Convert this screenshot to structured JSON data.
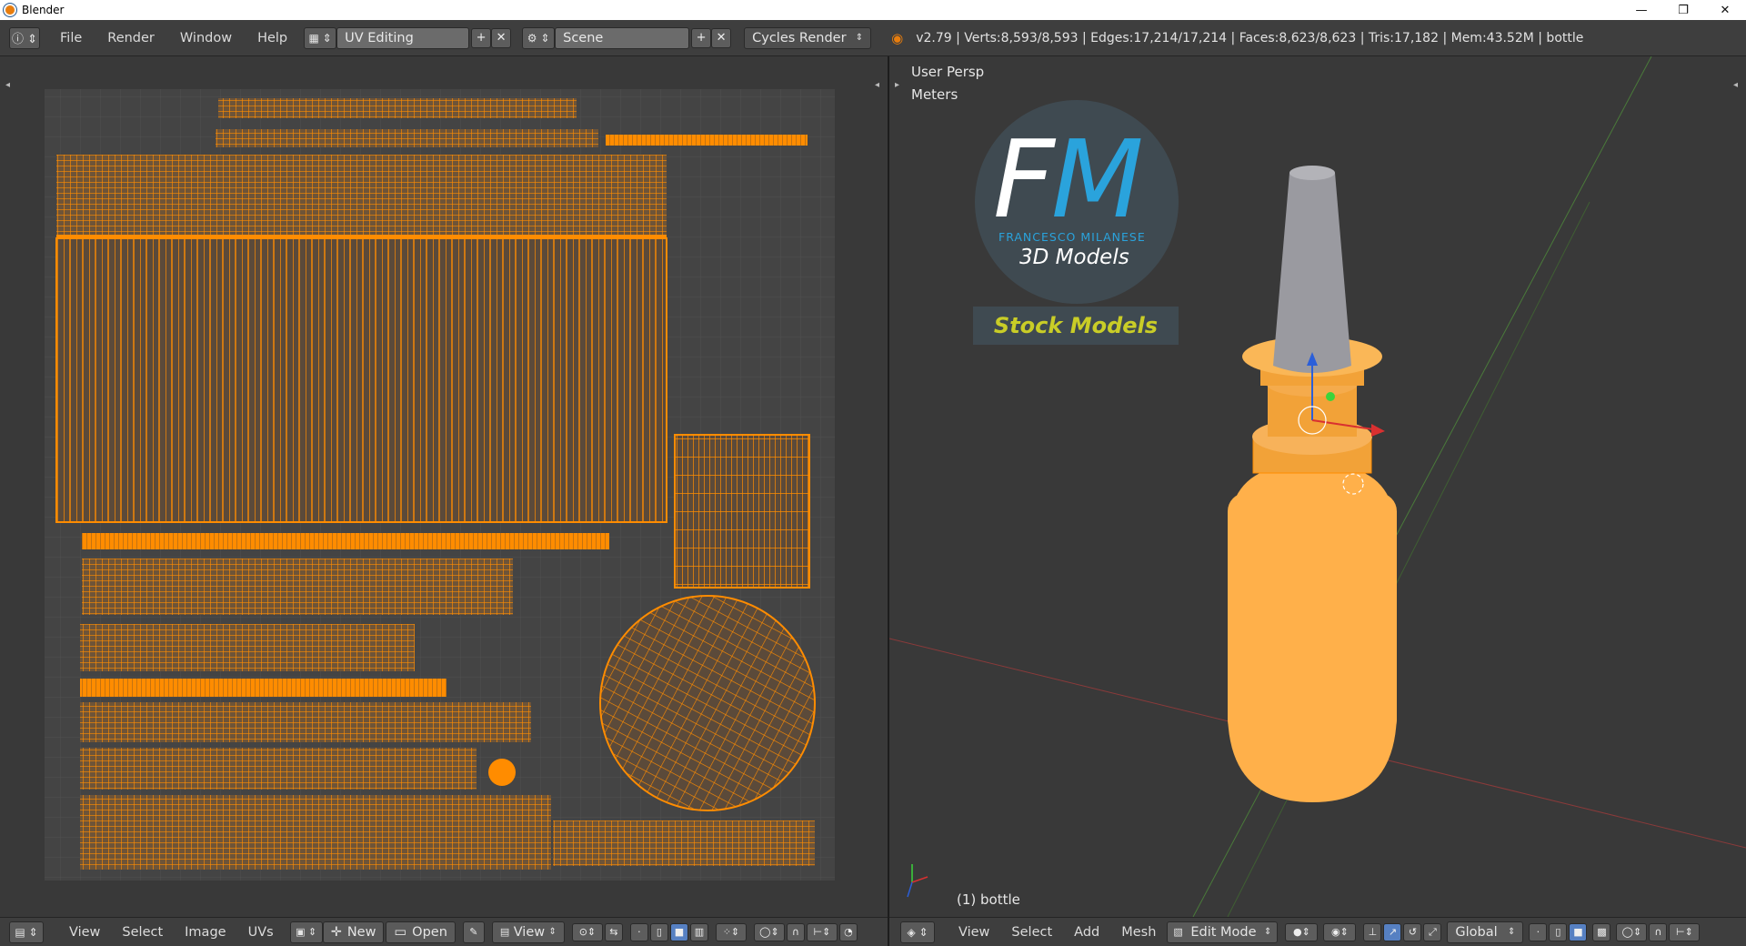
{
  "window": {
    "title": "Blender",
    "minimize": "—",
    "maximize": "❐",
    "close": "✕"
  },
  "topbar": {
    "menus": [
      "File",
      "Render",
      "Window",
      "Help"
    ],
    "layout": "UV Editing",
    "scene": "Scene",
    "engine": "Cycles Render",
    "stats": "v2.79 | Verts:8,593/8,593 | Edges:17,214/17,214 | Faces:8,623/8,623 | Tris:17,182 | Mem:43.52M | bottle"
  },
  "uv_editor": {
    "menus": [
      "View",
      "Select",
      "Image",
      "UVs"
    ],
    "new_label": "New",
    "open_label": "Open",
    "view_label": "View",
    "colors": {
      "bg": "#393939",
      "grid": "#4a4a4a",
      "uv": "#ff8c00"
    }
  },
  "viewport": {
    "view_name": "User Persp",
    "units": "Meters",
    "object_label": "(1) bottle",
    "menus": [
      "View",
      "Select",
      "Add",
      "Mesh"
    ],
    "mode": "Edit Mode",
    "orientation": "Global",
    "logo": {
      "letter_f": "F",
      "letter_m": "M",
      "subtitle": "FRANCESCO MILANESE",
      "tagline": "3D Models",
      "badge": "Stock Models"
    }
  }
}
